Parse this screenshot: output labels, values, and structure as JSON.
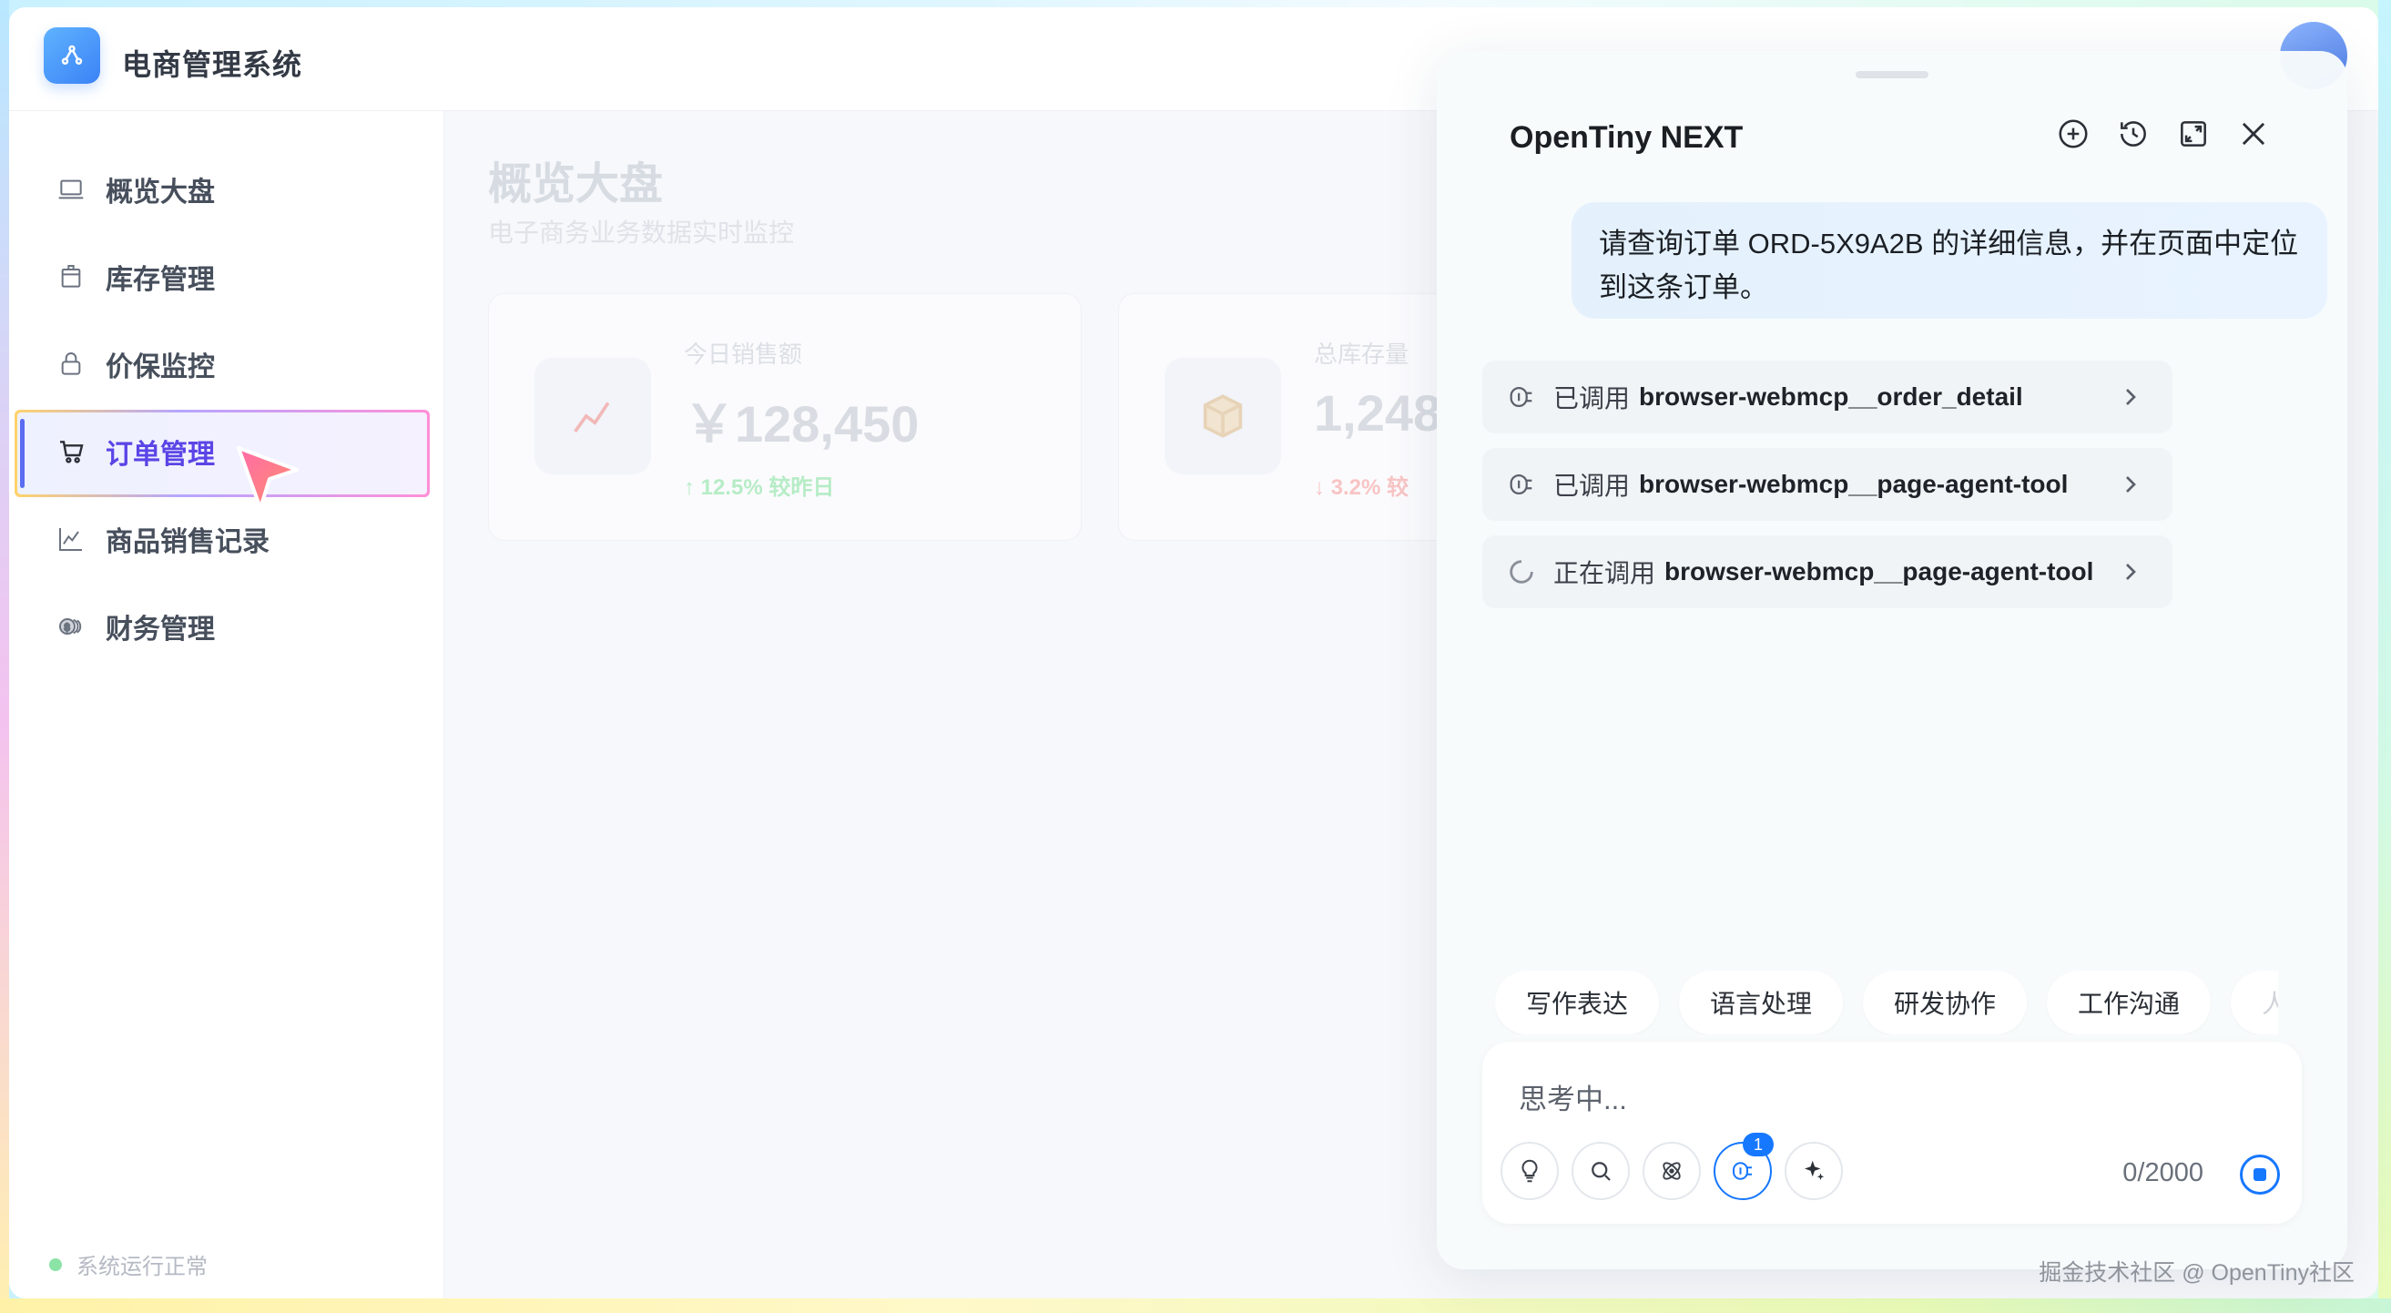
{
  "app": {
    "title": "电商管理系统",
    "user_text": "",
    "status_text": "系统运行正常"
  },
  "sidebar": {
    "items": [
      {
        "label": "概览大盘",
        "icon": "laptop-icon"
      },
      {
        "label": "库存管理",
        "icon": "box-icon"
      },
      {
        "label": "价保监控",
        "icon": "lock-icon"
      },
      {
        "label": "订单管理",
        "icon": "cart-icon",
        "active": true
      },
      {
        "label": "商品销售记录",
        "icon": "chart-icon"
      },
      {
        "label": "财务管理",
        "icon": "coins-icon"
      }
    ]
  },
  "main": {
    "title": "概览大盘",
    "subtitle": "电子商务业务数据实时监控",
    "cards": [
      {
        "label": "今日销售额",
        "value": "￥128,450",
        "delta": "↑ 12.5% 较昨日",
        "delta_color": "#b6ecc6"
      },
      {
        "label": "总库存量",
        "value": "1,248",
        "delta": "↓ 3.2% 较",
        "delta_color": "#f8c4c4"
      }
    ]
  },
  "chat": {
    "title": "OpenTiny NEXT",
    "user_message": "请查询订单 ORD-5X9A2B 的详细信息，并在页面中定位到这条订单。",
    "tool_calls": [
      {
        "status": "已调用",
        "name": "browser-webmcp__order_detail"
      },
      {
        "status": "已调用",
        "name": "browser-webmcp__page-agent-tool"
      },
      {
        "status": "正在调用",
        "name": "browser-webmcp__page-agent-tool"
      }
    ],
    "chips": [
      "写作表达",
      "语言处理",
      "研发协作",
      "工作沟通",
      "人才"
    ],
    "input_placeholder": "思考中...",
    "counter": "0/2000",
    "badge_count": "1"
  },
  "watermark": "掘金技术社区 @ OpenTiny社区",
  "colors": {
    "accent": "#1677ff",
    "active_nav": "#5a45e6",
    "brand": "#3b82f6"
  }
}
